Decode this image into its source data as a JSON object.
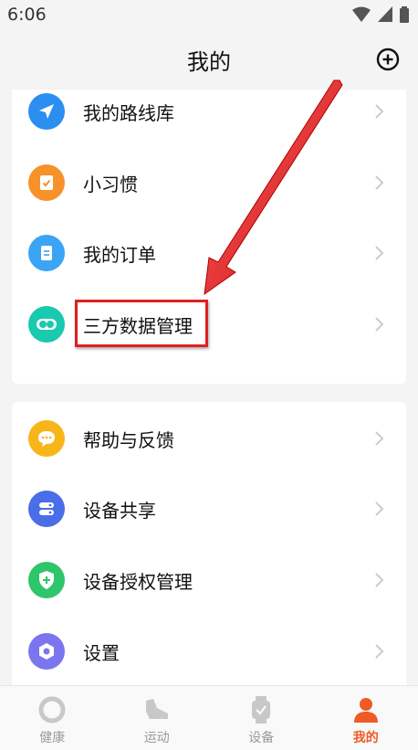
{
  "status": {
    "time": "6:06"
  },
  "header": {
    "title": "我的"
  },
  "menu_group1": [
    {
      "label": "我的路线库",
      "icon": "navigation-icon",
      "color": "#2b8ef0"
    },
    {
      "label": "小习惯",
      "icon": "habit-check-icon",
      "color": "#f7922a"
    },
    {
      "label": "我的订单",
      "icon": "order-document-icon",
      "color": "#3aa4f5"
    },
    {
      "label": "三方数据管理",
      "icon": "toggle-link-icon",
      "color": "#19c9b0"
    }
  ],
  "menu_group2": [
    {
      "label": "帮助与反馈",
      "icon": "chat-bubble-icon",
      "color": "#f8b51a"
    },
    {
      "label": "设备共享",
      "icon": "share-device-icon",
      "color": "#4a6ee8"
    },
    {
      "label": "设备授权管理",
      "icon": "shield-plus-icon",
      "color": "#2fc56a"
    },
    {
      "label": "设置",
      "icon": "settings-hexagon-icon",
      "color": "#7b76f0"
    }
  ],
  "bottom_nav": [
    {
      "label": "健康",
      "icon": "health-ring-icon"
    },
    {
      "label": "运动",
      "icon": "shoe-icon"
    },
    {
      "label": "设备",
      "icon": "watch-icon"
    },
    {
      "label": "我的",
      "icon": "person-icon",
      "active": true
    }
  ],
  "colors": {
    "accent": "#f05a24",
    "highlight": "#e02020"
  }
}
